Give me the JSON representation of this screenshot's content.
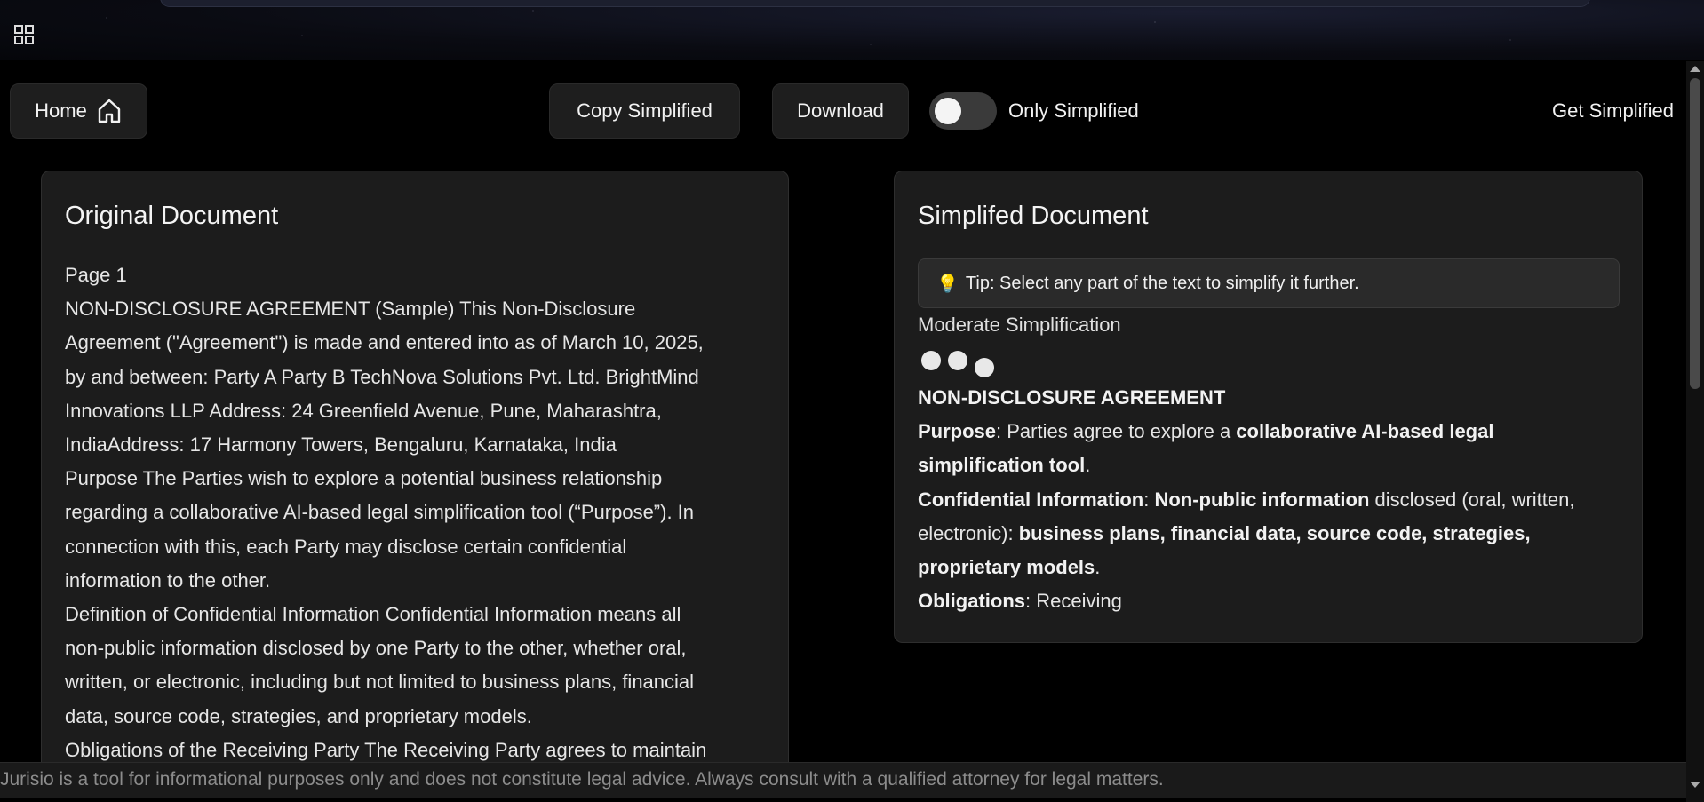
{
  "header": {
    "apps_icon": "grid-icon"
  },
  "toolbar": {
    "home_label": "Home",
    "home_icon": "home-icon",
    "copy_label": "Copy Simplified",
    "download_label": "Download",
    "toggle_label": "Only Simplified",
    "toggle_on": false,
    "get_simplified_label": "Get Simplified"
  },
  "original": {
    "title": "Original Document",
    "lines": [
      "Page 1",
      "NON-DISCLOSURE AGREEMENT (Sample) This Non-Disclosure",
      "Agreement (\"Agreement\") is made and entered into as of March 10, 2025,",
      "by and between: Party A Party B TechNova Solutions Pvt. Ltd. BrightMind",
      "Innovations LLP Address: 24 Greenfield Avenue, Pune, Maharashtra,",
      "IndiaAddress: 17 Harmony Towers, Bengaluru, Karnataka, India",
      "Purpose The Parties wish to explore a potential business relationship",
      "regarding a collaborative AI-based legal simplification tool (“Purpose”). In",
      "connection with this, each Party may disclose certain confidential",
      "information to the other.",
      "Definition of Confidential Information Confidential Information means all",
      "non-public information disclosed by one Party to the other, whether oral,",
      "written, or electronic, including but not limited to business plans, financial",
      "data, source code, strategies, and proprietary models.",
      "Obligations of the Receiving Party The Receiving Party agrees to maintain"
    ]
  },
  "simplified": {
    "title": "Simplifed Document",
    "tip": "Tip: Select any part of the text to simplify it further.",
    "tip_icon": "lightbulb-icon",
    "mode": "Moderate Simplification",
    "heading": "NON-DISCLOSURE AGREEMENT",
    "purpose_label": "Purpose",
    "purpose_text": ": Parties agree to explore a ",
    "purpose_bold": "collaborative AI-based legal simplification tool",
    "purpose_end": ".",
    "conf_label": "Confidential Information",
    "conf_sep": ": ",
    "conf_bold1": "Non-public information",
    "conf_text": " disclosed (oral, written, electronic): ",
    "conf_bold2": "business plans, financial data, source code, strategies, proprietary models",
    "conf_end": ".",
    "oblig_label": "Obligations",
    "oblig_text": ": Receiving"
  },
  "footer": {
    "disclaimer": "Jurisio is a tool for informational purposes only and does not constitute legal advice. Always consult with a qualified attorney for legal matters."
  }
}
